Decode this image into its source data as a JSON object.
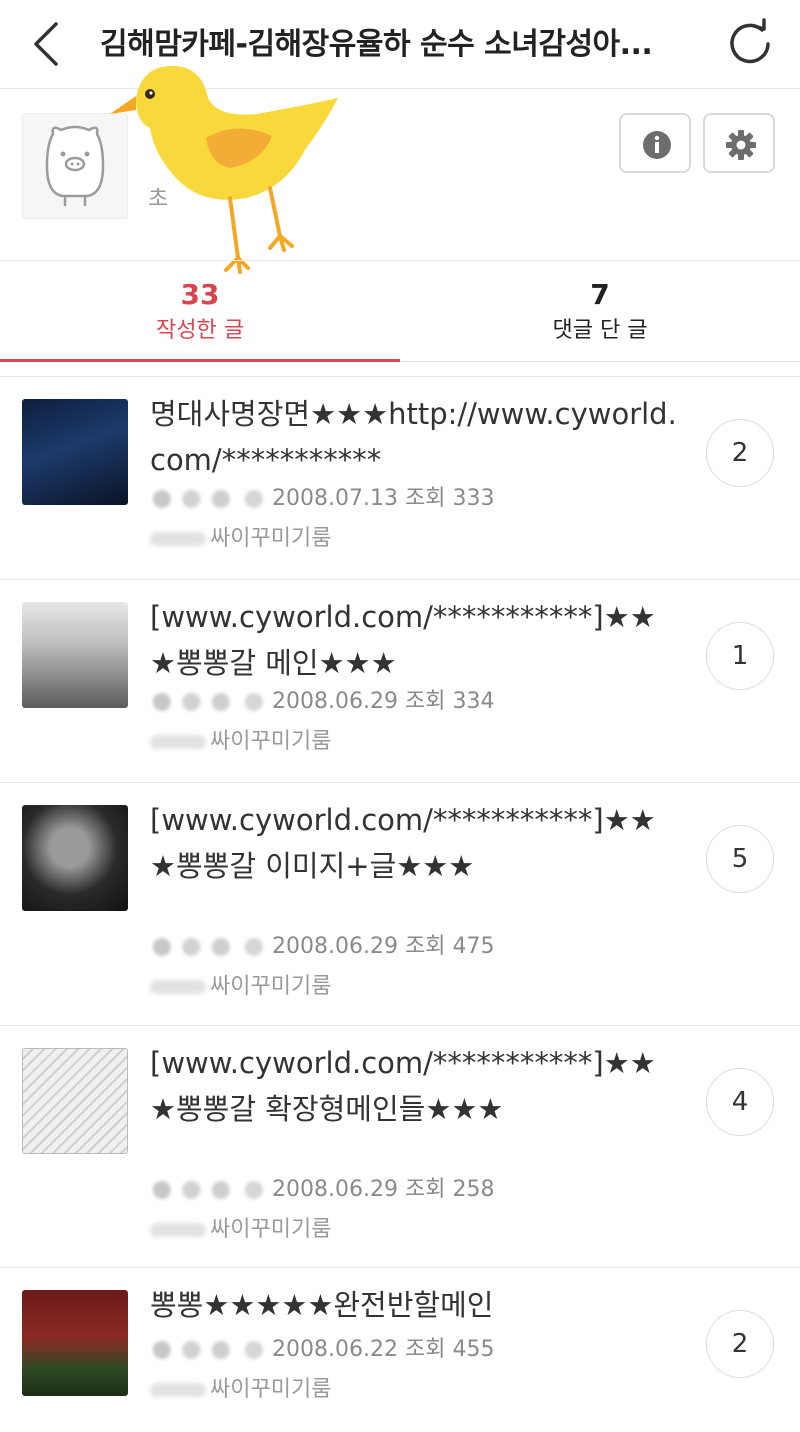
{
  "header": {
    "title": "김해맘카페-김해장유율하 순수 소녀감성아...",
    "back_icon": "chevron-left-icon",
    "refresh_icon": "refresh-icon"
  },
  "profile": {
    "nickname_partial": "초",
    "avatar_icon": "pig-character-icon",
    "info_icon": "info-icon",
    "settings_icon": "gear-icon"
  },
  "tabs": [
    {
      "count": "33",
      "label": "작성한 글",
      "active": true
    },
    {
      "count": "7",
      "label": "댓글 단 글",
      "active": false
    }
  ],
  "colors": {
    "accent": "#d9454f",
    "border": "#e6e6e6",
    "meta": "#8a8a8a"
  },
  "posts": [
    {
      "title": "명대사명장면★★★http://www.cyworld.com/***********",
      "date": "2008.07.13",
      "views_label": "조회",
      "views": "333",
      "club": "싸이꾸미기룸",
      "comments": "2"
    },
    {
      "title": "[www.cyworld.com/***********]★★★뽕뽕갈 메인★★★",
      "date": "2008.06.29",
      "views_label": "조회",
      "views": "334",
      "club": "싸이꾸미기룸",
      "comments": "1"
    },
    {
      "title": "[www.cyworld.com/***********]★★★뽕뽕갈 이미지+글★★★",
      "date": "2008.06.29",
      "views_label": "조회",
      "views": "475",
      "club": "싸이꾸미기룸",
      "comments": "5"
    },
    {
      "title": "[www.cyworld.com/***********]★★★뽕뽕갈 확장형메인들★★★",
      "date": "2008.06.29",
      "views_label": "조회",
      "views": "258",
      "club": "싸이꾸미기룸",
      "comments": "4"
    },
    {
      "title": "뽕뽕★★★★★완전반할메인",
      "date": "2008.06.22",
      "views_label": "조회",
      "views": "455",
      "club": "싸이꾸미기룸",
      "comments": "2"
    }
  ]
}
